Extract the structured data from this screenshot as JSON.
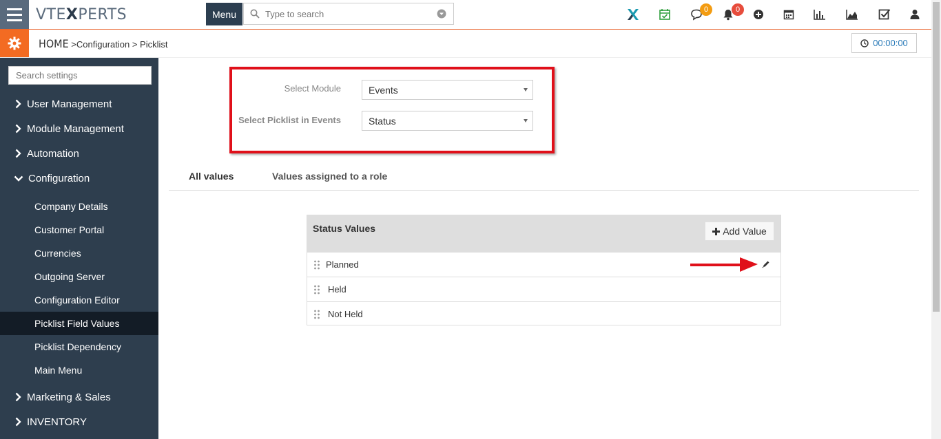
{
  "brand": {
    "logo_text_1": "VTE",
    "logo_text_2": "X",
    "logo_text_3": "PERTS"
  },
  "topbar": {
    "menu_label": "Menu",
    "search_placeholder": "Type to search",
    "chat_badge": "0",
    "notify_badge": "0",
    "colors": {
      "chat_badge": "#f39c12",
      "notify_badge": "#e74c3c",
      "accent": "#f36b22"
    }
  },
  "breadcrumb": {
    "home": "HOME",
    "sep1": " >",
    "item1": "Configuration",
    "sep2": " > ",
    "item2": "Picklist"
  },
  "timer": {
    "value": "00:00:00"
  },
  "sidebar": {
    "search_placeholder": "Search settings",
    "sections": [
      {
        "label": "User Management"
      },
      {
        "label": "Module Management"
      },
      {
        "label": "Automation"
      },
      {
        "label": "Configuration"
      },
      {
        "label": "Marketing & Sales"
      },
      {
        "label": "INVENTORY"
      }
    ],
    "config_items": [
      {
        "label": "Company Details"
      },
      {
        "label": "Customer Portal"
      },
      {
        "label": "Currencies"
      },
      {
        "label": "Outgoing Server"
      },
      {
        "label": "Configuration Editor"
      },
      {
        "label": "Picklist Field Values"
      },
      {
        "label": "Picklist Dependency"
      },
      {
        "label": "Main Menu"
      }
    ],
    "active_item": "Picklist Field Values"
  },
  "form": {
    "module_label": "Select Module",
    "module_value": "Events",
    "picklist_label": "Select Picklist in Events",
    "picklist_value": "Status"
  },
  "tabs": [
    {
      "label": "All values",
      "active": true
    },
    {
      "label": "Values assigned to a role",
      "active": false
    }
  ],
  "panel": {
    "title": "Status Values",
    "add_button": "Add Value",
    "rows": [
      {
        "value": "Planned"
      },
      {
        "value": "Held"
      },
      {
        "value": "Not Held"
      }
    ]
  }
}
